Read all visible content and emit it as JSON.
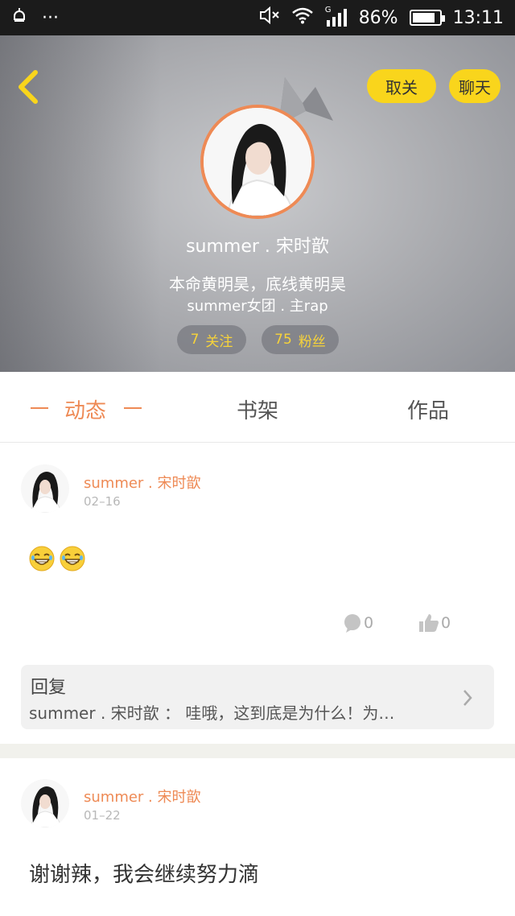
{
  "status_bar": {
    "left_icons": [
      "bug-icon",
      "more-dots-icon"
    ],
    "more_glyph": "···",
    "battery_percent": "86%",
    "battery_level": 0.86,
    "time": "13:11",
    "signal_label": "G"
  },
  "profile": {
    "name": "summer . 宋时歆",
    "bio_line1": "本命黄明昊，底线黄明昊",
    "bio_line2": "summer女团 . 主rap",
    "following_count": "7",
    "following_label": "关注",
    "followers_count": "75",
    "followers_label": "粉丝",
    "unfollow_label": "取关",
    "chat_label": "聊天",
    "accent_color": "#ee8a55",
    "button_color": "#f9d51c"
  },
  "tabs": [
    {
      "label": "动态",
      "active": true
    },
    {
      "label": "书架",
      "active": false
    },
    {
      "label": "作品",
      "active": false
    }
  ],
  "posts": [
    {
      "author": "summer . 宋时歆",
      "date": "02–16",
      "content_icons": [
        "laughing-emoji-icon",
        "laughing-emoji-icon"
      ],
      "comments": "0",
      "likes": "0",
      "reply": {
        "title": "回复",
        "text": "summer . 宋时歆 ： 哇哦，这到底是为什么！为…"
      }
    },
    {
      "author": "summer . 宋时歆",
      "date": "01–22",
      "content_text": "谢谢辣，我会继续努力滴"
    }
  ]
}
